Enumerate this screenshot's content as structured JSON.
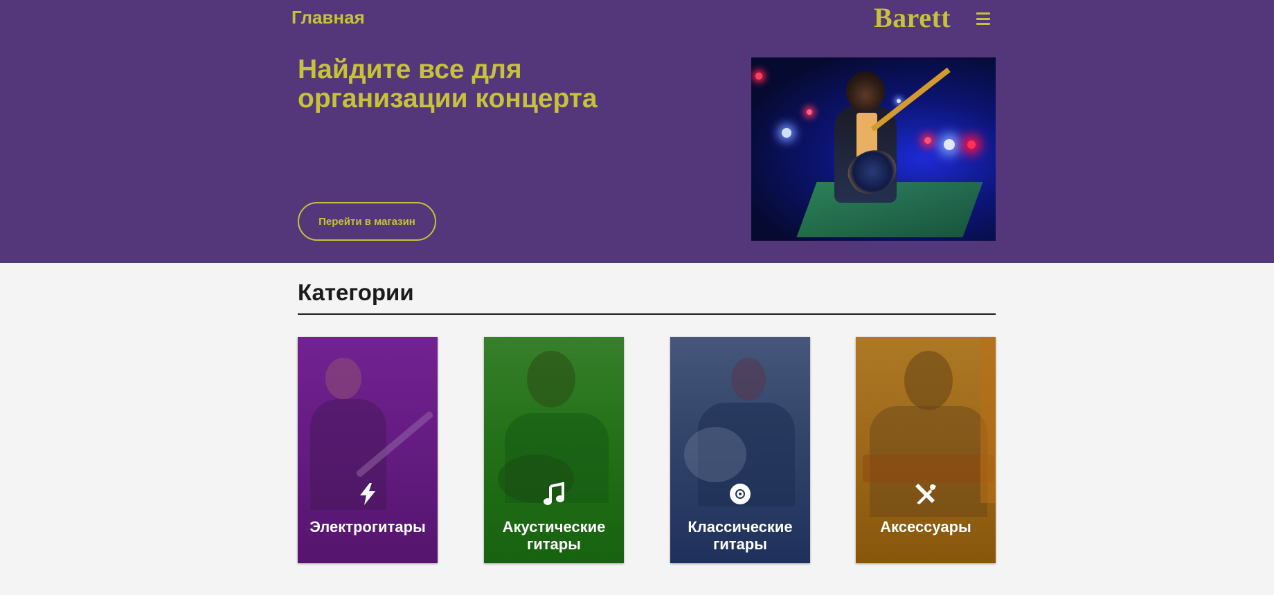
{
  "nav": {
    "home_label": "Главная",
    "brand": "Barett",
    "menu_icon": "hamburger-icon"
  },
  "hero": {
    "title": "Найдите все для организации концерта",
    "cta_label": "Перейти в магазин",
    "image_subject": "guitarist-on-stage-photo"
  },
  "categories": {
    "title": "Категории",
    "items": [
      {
        "label": "Электрогитары",
        "icon": "lightning-icon",
        "color": "#5e1a7a"
      },
      {
        "label": "Акустические гитары",
        "icon": "music-note-icon",
        "color": "#1b6a12"
      },
      {
        "label": "Классические гитары",
        "icon": "disc-icon",
        "color": "#1f3566"
      },
      {
        "label": "Аксессуары",
        "icon": "tools-icon",
        "color": "#9a6410"
      }
    ]
  },
  "colors": {
    "hero_bg": "#53377a",
    "accent": "#c7c238",
    "page_bg": "#f4f4f4",
    "text_dark": "#1b1b1b"
  }
}
